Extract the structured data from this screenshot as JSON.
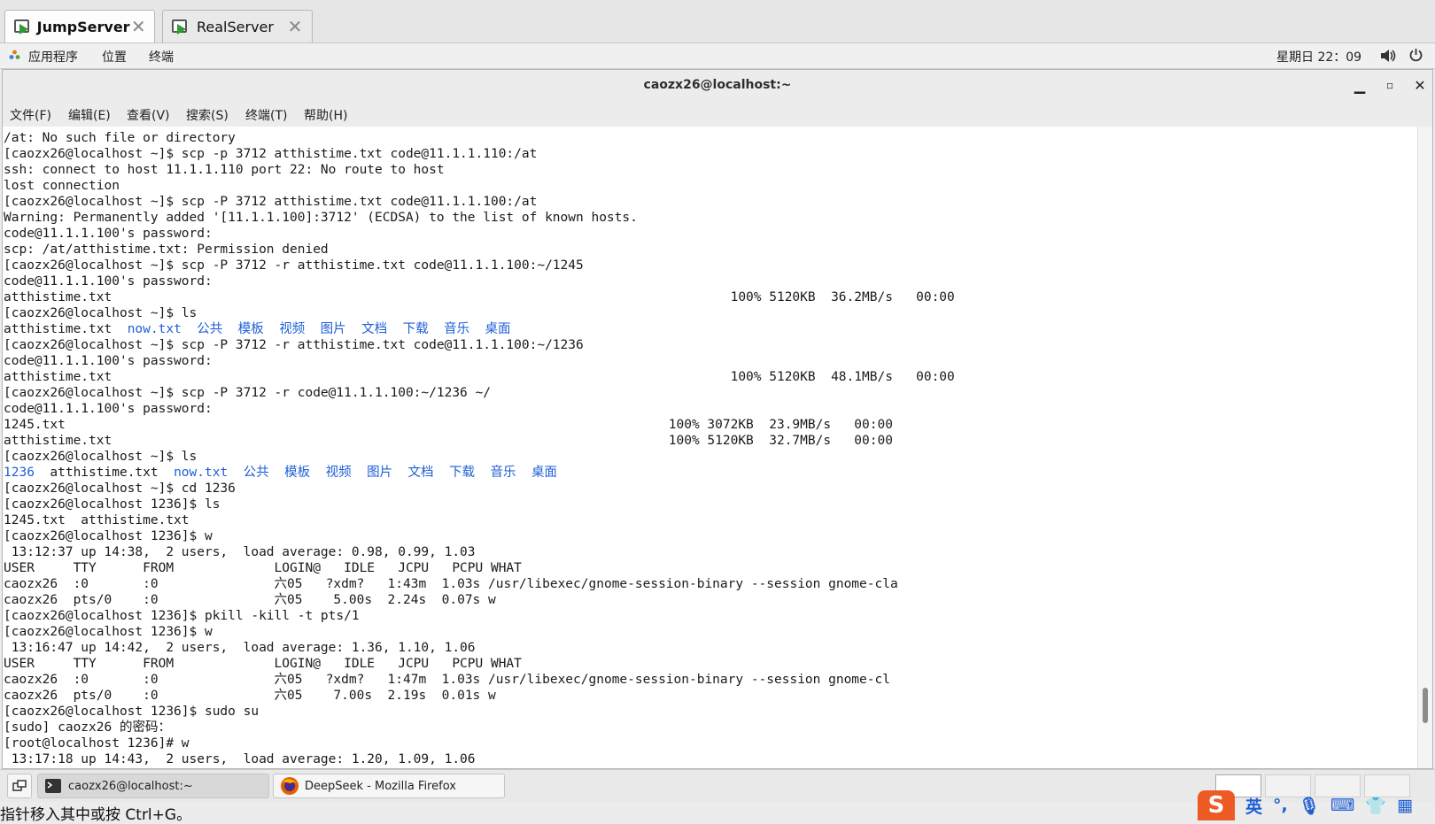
{
  "vm_tabs": [
    {
      "label": "JumpServer",
      "active": true
    },
    {
      "label": "RealServer",
      "active": false
    }
  ],
  "topbar": {
    "menus": [
      "应用程序",
      "位置",
      "终端"
    ],
    "clock": "星期日 22：09",
    "icons": [
      "volume-icon",
      "power-icon"
    ]
  },
  "window": {
    "title": "caozx26@localhost:~",
    "menus": [
      "文件(F)",
      "编辑(E)",
      "查看(V)",
      "搜索(S)",
      "终端(T)",
      "帮助(H)"
    ]
  },
  "terminal": {
    "lines": [
      "/at: No such file or directory",
      "[caozx26@localhost ~]$ scp -p 3712 atthistime.txt code@11.1.1.110:/at",
      "ssh: connect to host 11.1.1.110 port 22: No route to host",
      "lost connection",
      "[caozx26@localhost ~]$ scp -P 3712 atthistime.txt code@11.1.1.100:/at",
      "Warning: Permanently added '[11.1.1.100]:3712' (ECDSA) to the list of known hosts.",
      "code@11.1.1.100's password:",
      "scp: /at/atthistime.txt: Permission denied",
      "[caozx26@localhost ~]$ scp -P 3712 -r atthistime.txt code@11.1.1.100:~/1245",
      "code@11.1.1.100's password:",
      "atthistime.txt                                                                                100% 5120KB  36.2MB/s   00:00",
      "[caozx26@localhost ~]$ ls",
      "atthistime.txt  now.txt  公共  模板  视频  图片  文档  下载  音乐  桌面",
      "[caozx26@localhost ~]$ scp -P 3712 -r atthistime.txt code@11.1.1.100:~/1236",
      "code@11.1.1.100's password:",
      "atthistime.txt                                                                                100% 5120KB  48.1MB/s   00:00",
      "[caozx26@localhost ~]$ scp -P 3712 -r code@11.1.1.100:~/1236 ~/",
      "code@11.1.1.100's password:",
      "1245.txt                                                                              100% 3072KB  23.9MB/s   00:00",
      "atthistime.txt                                                                        100% 5120KB  32.7MB/s   00:00",
      "[caozx26@localhost ~]$ ls",
      "1236  atthistime.txt  now.txt  公共  模板  视频  图片  文档  下载  音乐  桌面",
      "[caozx26@localhost ~]$ cd 1236",
      "[caozx26@localhost 1236]$ ls",
      "1245.txt  atthistime.txt",
      "[caozx26@localhost 1236]$ w",
      " 13:12:37 up 14:38,  2 users,  load average: 0.98, 0.99, 1.03",
      "USER     TTY      FROM             LOGIN@   IDLE   JCPU   PCPU WHAT",
      "caozx26  :0       :0               六05   ?xdm?   1:43m  1.03s /usr/libexec/gnome-session-binary --session gnome-cla",
      "caozx26  pts/0    :0               六05    5.00s  2.24s  0.07s w",
      "[caozx26@localhost 1236]$ pkill -kill -t pts/1",
      "[caozx26@localhost 1236]$ w",
      " 13:16:47 up 14:42,  2 users,  load average: 1.36, 1.10, 1.06",
      "USER     TTY      FROM             LOGIN@   IDLE   JCPU   PCPU WHAT",
      "caozx26  :0       :0               六05   ?xdm?   1:47m  1.03s /usr/libexec/gnome-session-binary --session gnome-cl",
      "caozx26  pts/0    :0               六05    7.00s  2.19s  0.01s w",
      "[caozx26@localhost 1236]$ sudo su",
      "[sudo] caozx26 的密码：",
      "[root@localhost 1236]# w",
      " 13:17:18 up 14:43,  2 users,  load average: 1.20, 1.09, 1.06"
    ]
  },
  "taskbar": {
    "items": [
      {
        "label": "caozx26@localhost:~",
        "active": true
      },
      {
        "label": "DeepSeek - Mozilla Firefox",
        "active": false
      }
    ]
  },
  "status_hint": "指针移入其中或按 Ctrl+G。",
  "ime": {
    "logo": "S",
    "lang": "英"
  },
  "colors": {
    "link_blue": "#1f5fd6",
    "ime_orange": "#ee5a24"
  }
}
